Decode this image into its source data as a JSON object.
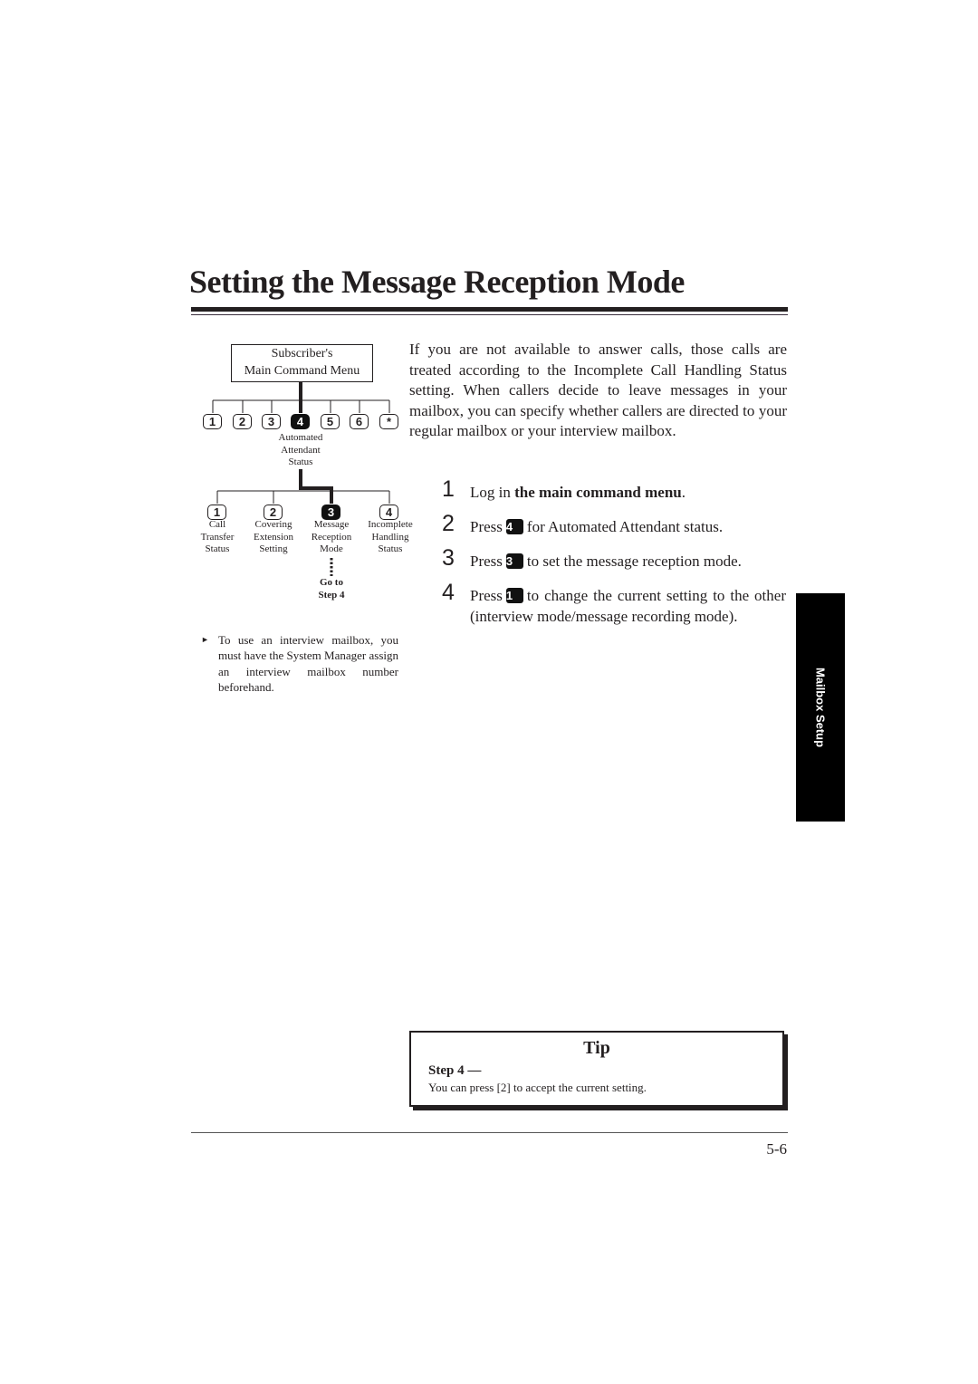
{
  "page": {
    "title": "Setting the Message Reception Mode",
    "page_number": "5-6",
    "section_tab": "Mailbox Setup"
  },
  "diagram": {
    "root_label_line1": "Subscriber's",
    "root_label_line2": "Main Command Menu",
    "level1_keys": [
      "1",
      "2",
      "3",
      "4",
      "5",
      "6",
      "*"
    ],
    "level1_active_index": 3,
    "level1_active_label": [
      "Automated",
      "Attendant",
      "Status"
    ],
    "level2": [
      {
        "key": "1",
        "label": [
          "Call",
          "Transfer",
          "Status"
        ]
      },
      {
        "key": "2",
        "label": [
          "Covering",
          "Extension",
          "Setting"
        ]
      },
      {
        "key": "3",
        "label": [
          "Message",
          "Reception",
          "Mode"
        ],
        "active": true
      },
      {
        "key": "4",
        "label": [
          "Incomplete",
          "Handling",
          "Status"
        ]
      }
    ],
    "goto_line1": "Go to",
    "goto_line2": "Step 4"
  },
  "note": {
    "text": "To use an interview mailbox, you must have the System Manager assign an interview mailbox number beforehand."
  },
  "intro": "If you are not available to answer calls, those calls are treated according to the Incomplete Call Handling Status setting. When callers decide to leave messages in your mailbox, you can specify whether callers are directed to your regular mailbox or your interview mailbox.",
  "steps": [
    {
      "num": "1",
      "pre": "Log in ",
      "bold": "the main command menu",
      "post": "."
    },
    {
      "num": "2",
      "pre": "Press",
      "key": "4",
      "post": "for Automated Attendant status."
    },
    {
      "num": "3",
      "pre": "Press",
      "key": "3",
      "post": "to set the message reception mode."
    },
    {
      "num": "4",
      "pre": "Press",
      "key": "1",
      "post": "to change the current setting to the other (interview mode/message recording mode)."
    }
  ],
  "tip": {
    "title": "Tip",
    "step_label": "Step 4 —",
    "text": "You can press [2] to accept the current setting."
  }
}
